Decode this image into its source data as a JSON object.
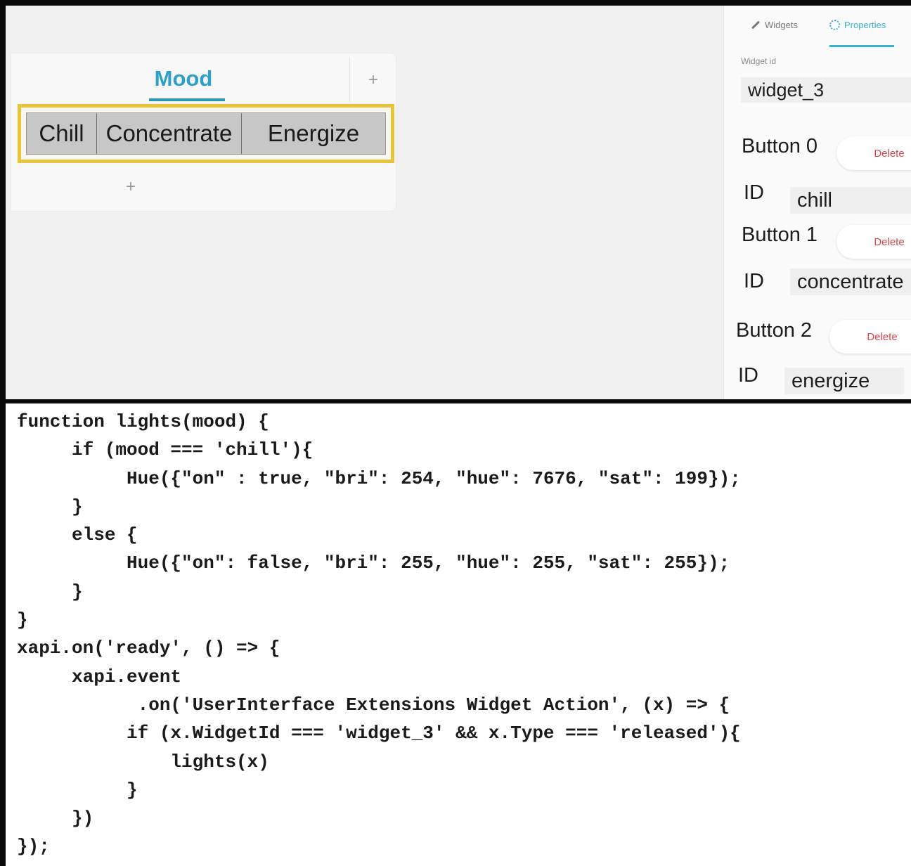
{
  "canvas": {
    "tab_title": "Mood",
    "add_symbol": "+",
    "buttons": [
      "Chill",
      "Concentrate",
      "Energize"
    ],
    "add_row_symbol": "+",
    "accent_color": "#2ea0c8",
    "selection_color": "#e8c43a"
  },
  "properties_panel": {
    "tabs": {
      "widgets": "Widgets",
      "properties": "Properties"
    },
    "widget_id_label": "Widget id",
    "widget_id_value": "widget_3",
    "delete_label": "Delete",
    "id_label": "ID",
    "buttons": [
      {
        "label": "Button 0",
        "id": "chill"
      },
      {
        "label": "Button 1",
        "id": "concentrate"
      },
      {
        "label": "Button 2",
        "id": "energize"
      }
    ]
  },
  "code": "function lights(mood) {\n     if (mood === 'chill'){\n          Hue({\"on\" : true, \"bri\": 254, \"hue\": 7676, \"sat\": 199});\n     }\n     else {\n          Hue({\"on\": false, \"bri\": 255, \"hue\": 255, \"sat\": 255});\n     }\n}\nxapi.on('ready', () => {\n     xapi.event\n           .on('UserInterface Extensions Widget Action', (x) => {\n          if (x.WidgetId === 'widget_3' && x.Type === 'released'){\n              lights(x)\n          }\n     })\n});"
}
